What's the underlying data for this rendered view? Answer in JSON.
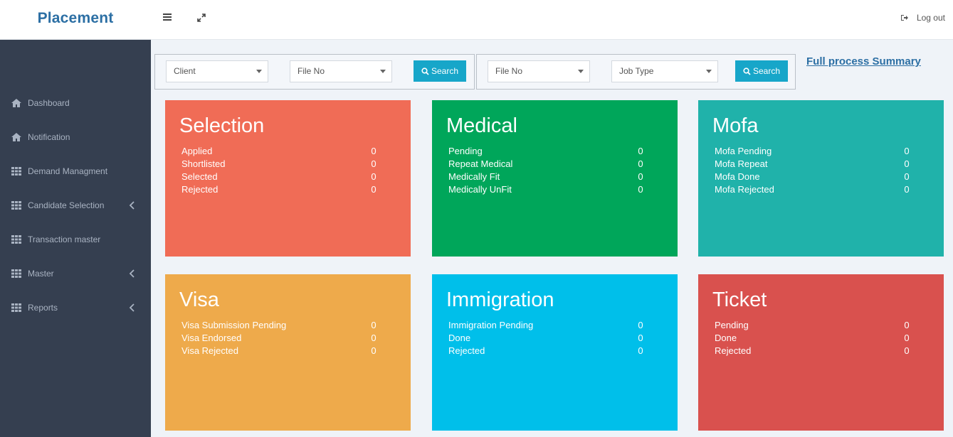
{
  "header": {
    "brand": "Placement",
    "logout_label": "Log out",
    "icons": {
      "menu": "menu-icon",
      "expand": "expand-icon",
      "logout": "logout-icon"
    }
  },
  "sidebar": {
    "items": [
      {
        "label": "Dashboard",
        "icon": "home-icon",
        "has_submenu": false
      },
      {
        "label": "Notification",
        "icon": "home-icon",
        "has_submenu": false
      },
      {
        "label": "Demand Managment",
        "icon": "grid-icon",
        "has_submenu": false
      },
      {
        "label": "Candidate Selection",
        "icon": "grid-icon",
        "has_submenu": true
      },
      {
        "label": "Transaction master",
        "icon": "grid-icon",
        "has_submenu": false
      },
      {
        "label": "Master",
        "icon": "grid-icon",
        "has_submenu": true
      },
      {
        "label": "Reports",
        "icon": "grid-icon",
        "has_submenu": true
      }
    ]
  },
  "filters": {
    "group1": {
      "select1": "Client",
      "select2": "File No",
      "search_label": "Search"
    },
    "group2": {
      "select1": "File No",
      "select2": "Job Type",
      "search_label": "Search"
    },
    "summary_link": "Full process Summary"
  },
  "cards": [
    {
      "title": "Selection",
      "color": "#f06c56",
      "rows": [
        {
          "label": "Applied",
          "value": "0"
        },
        {
          "label": "Shortlisted",
          "value": "0"
        },
        {
          "label": "Selected",
          "value": "0"
        },
        {
          "label": "Rejected",
          "value": "0"
        }
      ]
    },
    {
      "title": "Medical",
      "color": "#00a65a",
      "rows": [
        {
          "label": "Pending",
          "value": "0"
        },
        {
          "label": "Repeat Medical",
          "value": "0"
        },
        {
          "label": "Medically Fit",
          "value": "0"
        },
        {
          "label": "Medically UnFit",
          "value": "0"
        }
      ]
    },
    {
      "title": "Mofa",
      "color": "#20b2aa",
      "rows": [
        {
          "label": "Mofa Pending",
          "value": "0"
        },
        {
          "label": "Mofa Repeat",
          "value": "0"
        },
        {
          "label": "Mofa Done",
          "value": "0"
        },
        {
          "label": "Mofa Rejected",
          "value": "0"
        }
      ]
    },
    {
      "title": "Visa",
      "color": "#eeaa4b",
      "rows": [
        {
          "label": "Visa Submission Pending",
          "value": "0"
        },
        {
          "label": "Visa Endorsed",
          "value": "0"
        },
        {
          "label": "Visa Rejected",
          "value": "0"
        }
      ]
    },
    {
      "title": "Immigration",
      "color": "#00bfea",
      "rows": [
        {
          "label": "Immigration Pending",
          "value": "0"
        },
        {
          "label": "Done",
          "value": "0"
        },
        {
          "label": "Rejected",
          "value": "0"
        }
      ]
    },
    {
      "title": "Ticket",
      "color": "#d9514e",
      "rows": [
        {
          "label": "Pending",
          "value": "0"
        },
        {
          "label": "Done",
          "value": "0"
        },
        {
          "label": "Rejected",
          "value": "0"
        }
      ]
    }
  ]
}
